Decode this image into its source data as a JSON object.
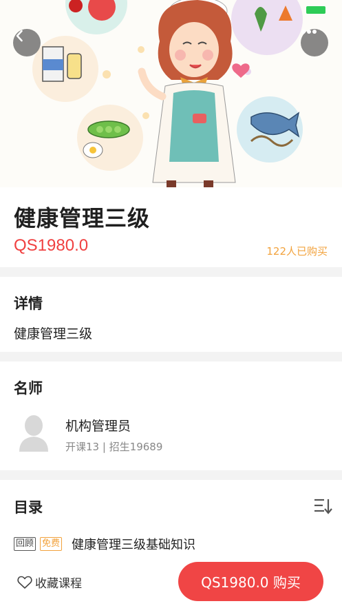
{
  "header": {
    "back_icon": "chevron-left-icon",
    "more_icon": "more-dots-icon"
  },
  "course": {
    "title": "健康管理三级",
    "price": "QS1980.0",
    "buyers": "122人已购买"
  },
  "details": {
    "heading": "详情",
    "text": "健康管理三级"
  },
  "teacher": {
    "heading": "名师",
    "name": "机构管理员",
    "stats": "开课13 | 招生19689"
  },
  "catalog": {
    "heading": "目录",
    "lessons": [
      {
        "tag_review": "回顾",
        "tag_free": "免费",
        "title": "健康管理三级基础知识"
      }
    ]
  },
  "bottom": {
    "favorite_label": "收藏课程",
    "buy_label": "QS1980.0 购买"
  },
  "colors": {
    "accent": "#f04545",
    "orange": "#f2a23c",
    "battery": "#2ecc57"
  }
}
